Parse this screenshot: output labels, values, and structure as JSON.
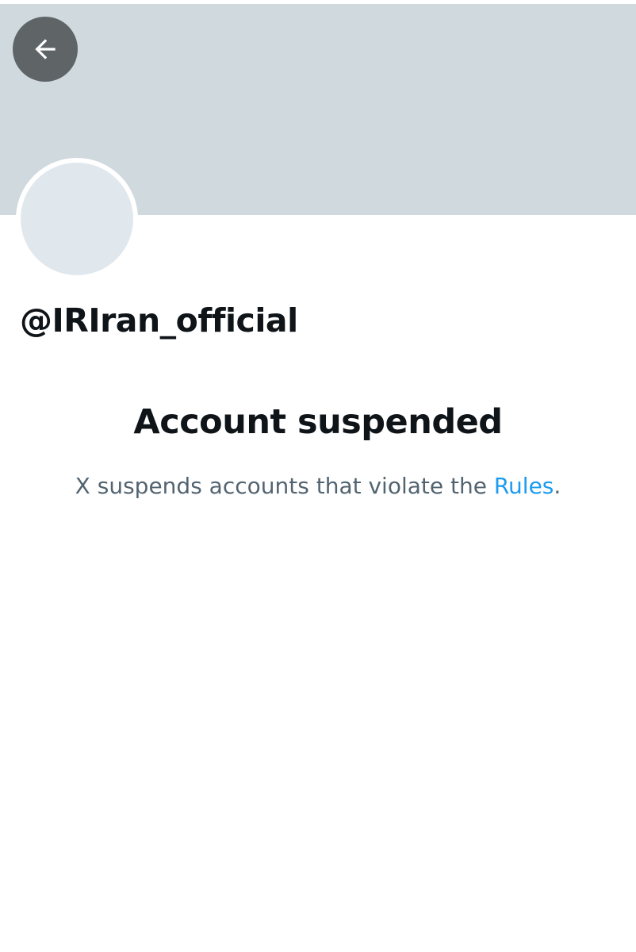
{
  "profile": {
    "handle": "@IRIran_official"
  },
  "suspension": {
    "title": "Account suspended",
    "message_prefix": "X suspends accounts that violate the ",
    "rules_link_label": "Rules",
    "message_suffix": "."
  },
  "icons": {
    "back": "arrow-left-icon"
  },
  "colors": {
    "banner": "#cfd9de",
    "avatar_placeholder": "#e1e8ed",
    "back_button": "#5f6467",
    "primary_text": "#0f1419",
    "secondary_text": "#536471",
    "link": "#1d9bf0"
  }
}
